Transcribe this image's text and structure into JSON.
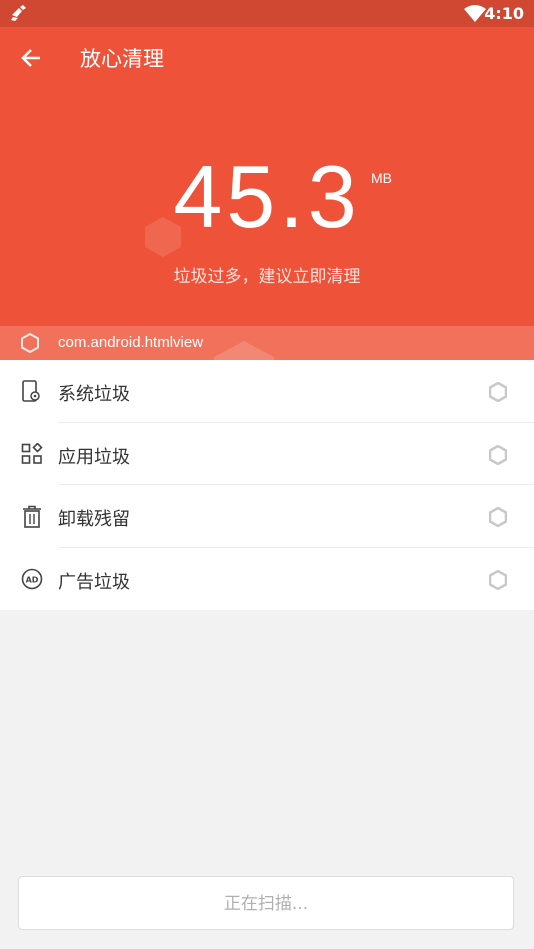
{
  "statusbar": {
    "time": "4:10"
  },
  "header": {
    "title": "放心清理"
  },
  "summary": {
    "size_value": "45.3",
    "size_unit": "MB",
    "hint": "垃圾过多，建议立即清理"
  },
  "scanning": {
    "current_package": "com.android.htmlview"
  },
  "categories": [
    {
      "label": "系统垃圾",
      "icon": "phone-gear-icon"
    },
    {
      "label": "应用垃圾",
      "icon": "apps-grid-icon"
    },
    {
      "label": "卸载残留",
      "icon": "trash-icon"
    },
    {
      "label": "广告垃圾",
      "icon": "ad-icon"
    }
  ],
  "footer": {
    "button_label": "正在扫描..."
  },
  "colors": {
    "accent": "#ee5238",
    "statusbar": "#d04732",
    "background": "#f2f2f2"
  }
}
